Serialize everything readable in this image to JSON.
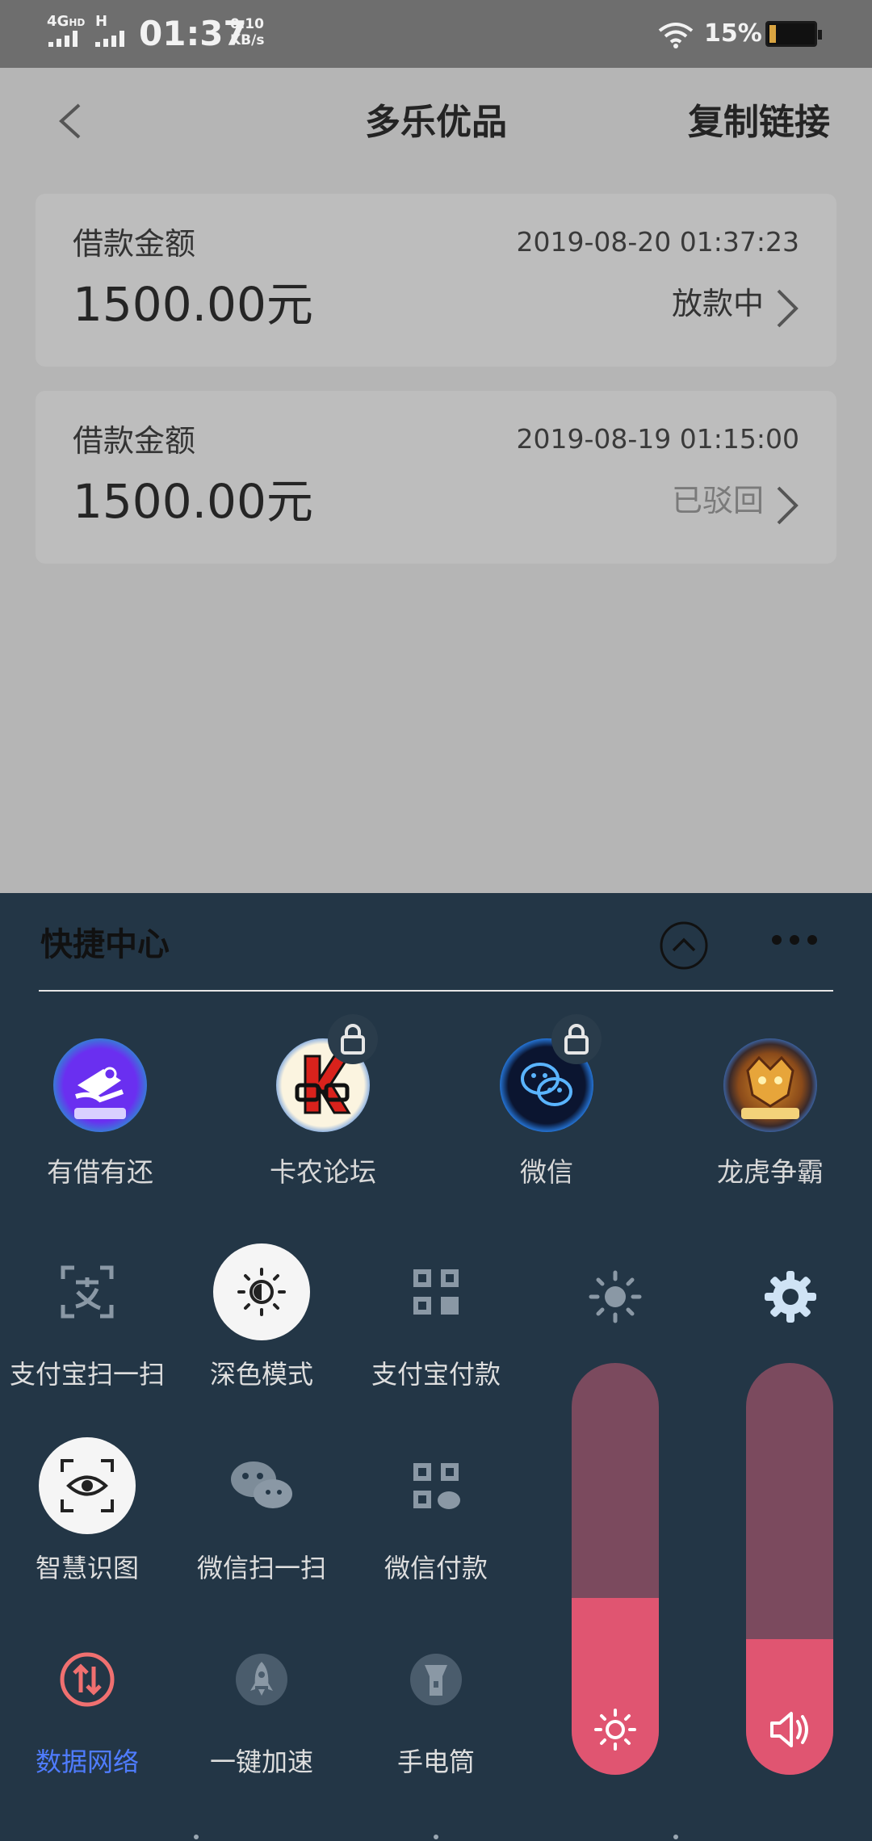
{
  "status_bar": {
    "network": "4G",
    "hd": "HD",
    "network2": "H",
    "time": "01:37",
    "speed_value": "0.10",
    "speed_unit": "KB/s",
    "battery": "15%"
  },
  "navbar": {
    "title": "多乐优品",
    "action": "复制链接"
  },
  "loans": [
    {
      "label": "借款金额",
      "date": "2019-08-20 01:37:23",
      "amount": "1500.00元",
      "status": "放款中",
      "status_color": "#333333"
    },
    {
      "label": "借款金额",
      "date": "2019-08-19 01:15:00",
      "amount": "1500.00元",
      "status": "已驳回",
      "status_color": "#7a7a7a"
    }
  ],
  "quick_center": {
    "title": "快捷中心",
    "apps": [
      {
        "label": "有借有还",
        "icon": "youjie-app-icon",
        "locked": false
      },
      {
        "label": "卡农论坛",
        "icon": "kanong-app-icon",
        "locked": true
      },
      {
        "label": "微信",
        "icon": "wechat-app-icon",
        "locked": true
      },
      {
        "label": "龙虎争霸",
        "icon": "longhu-app-icon",
        "locked": false
      }
    ],
    "toggles": [
      {
        "label": "支付宝扫一扫",
        "icon": "alipay-scan-icon",
        "active": false
      },
      {
        "label": "深色模式",
        "icon": "dark-mode-icon",
        "active": true
      },
      {
        "label": "支付宝付款",
        "icon": "alipay-pay-icon",
        "active": false
      },
      {
        "label": "智慧识图",
        "icon": "smart-vision-icon",
        "active": true
      },
      {
        "label": "微信扫一扫",
        "icon": "wechat-scan-icon",
        "active": false
      },
      {
        "label": "微信付款",
        "icon": "wechat-pay-icon",
        "active": false
      },
      {
        "label": "数据网络",
        "icon": "mobile-data-icon",
        "active": true,
        "label_color": "#4f7cff"
      },
      {
        "label": "一键加速",
        "icon": "rocket-icon",
        "active": false
      },
      {
        "label": "手电筒",
        "icon": "flashlight-icon",
        "active": false
      }
    ],
    "brightness_level": 0.43,
    "volume_level": 0.33,
    "accent_color": "#e05571"
  }
}
